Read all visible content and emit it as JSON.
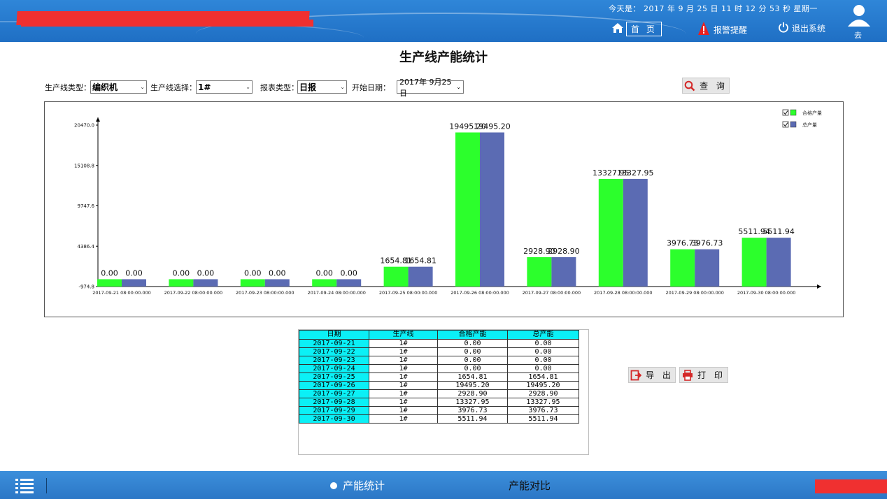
{
  "header": {
    "datetime": "今天是： 2017 年 9 月 25 日  11 时 12 分 53 秒    星期一",
    "home_label": "首 页",
    "alarm_label": "报警提醒",
    "exit_label": "退出系统",
    "user_name": "去"
  },
  "page": {
    "title": "生产线产能统计"
  },
  "filters": {
    "line_type_label": "生产线类型：",
    "line_type_value": "编织机",
    "line_select_label": "生产线选择：",
    "line_select_value": "1#",
    "report_type_label": "报表类型：",
    "report_type_value": "日报",
    "start_date_label": "开始日期：",
    "start_date_value": "2017年  9月25日",
    "query_label": "查 询"
  },
  "actions": {
    "export_label": "导 出",
    "print_label": "打 印"
  },
  "colors": {
    "qualified": "#2cff2c",
    "total": "#5b6bb3",
    "header_blue": "#2a7ccf",
    "cyan": "#0bf0f6"
  },
  "chart_data": {
    "type": "bar",
    "categories": [
      "2017-09-21 08:00:00.000",
      "2017-09-22 08:00:00.000",
      "2017-09-23 08:00:00.000",
      "2017-09-24 08:00:00.000",
      "2017-09-25 08:00:00.000",
      "2017-09-26 08:00:00.000",
      "2017-09-27 08:00:00.000",
      "2017-09-28 08:00:00.000",
      "2017-09-29 08:00:00.000",
      "2017-09-30 08:00:00.000"
    ],
    "series": [
      {
        "name": "合格产量",
        "color": "#2cff2c",
        "values": [
          0.0,
          0.0,
          0.0,
          0.0,
          1654.81,
          19495.2,
          2928.9,
          13327.95,
          3976.73,
          5511.94
        ]
      },
      {
        "name": "总产量",
        "color": "#5b6bb3",
        "values": [
          0.0,
          0.0,
          0.0,
          0.0,
          1654.81,
          19495.2,
          2928.9,
          13327.95,
          3976.73,
          5511.94
        ]
      }
    ],
    "yticks": [
      "20470.0",
      "15108.8",
      "9747.6",
      "4386.4",
      "-974.8"
    ],
    "ylim": [
      -974.8,
      20470.0
    ],
    "legend_position": "top-right"
  },
  "table": {
    "headers": [
      "日期",
      "生产线",
      "合格产能",
      "总产能"
    ],
    "rows": [
      [
        "2017-09-21",
        "1#",
        "0.00",
        "0.00"
      ],
      [
        "2017-09-22",
        "1#",
        "0.00",
        "0.00"
      ],
      [
        "2017-09-23",
        "1#",
        "0.00",
        "0.00"
      ],
      [
        "2017-09-24",
        "1#",
        "0.00",
        "0.00"
      ],
      [
        "2017-09-25",
        "1#",
        "1654.81",
        "1654.81"
      ],
      [
        "2017-09-26",
        "1#",
        "19495.20",
        "19495.20"
      ],
      [
        "2017-09-27",
        "1#",
        "2928.90",
        "2928.90"
      ],
      [
        "2017-09-28",
        "1#",
        "13327.95",
        "13327.95"
      ],
      [
        "2017-09-29",
        "1#",
        "3976.73",
        "3976.73"
      ],
      [
        "2017-09-30",
        "1#",
        "5511.94",
        "5511.94"
      ]
    ]
  },
  "footer": {
    "tab_stat": "产能统计",
    "tab_compare": "产能对比"
  }
}
